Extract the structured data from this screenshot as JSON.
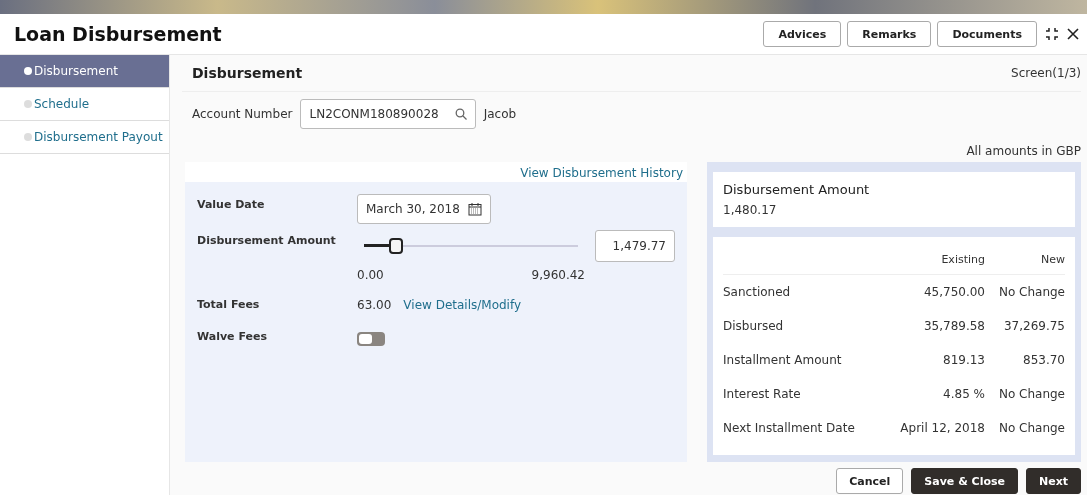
{
  "window": {
    "title": "Loan Disbursement",
    "buttons": [
      "Advices",
      "Remarks",
      "Documents"
    ]
  },
  "sidebar": {
    "items": [
      {
        "label": "Disbursement",
        "selected": true
      },
      {
        "label": "Schedule",
        "selected": false
      },
      {
        "label": "Disbursement Payout",
        "selected": false
      }
    ]
  },
  "section": {
    "title": "Disbursement",
    "screen": "Screen(1/3)"
  },
  "account": {
    "label": "Account Number",
    "value": "LN2CONM180890028",
    "name": "Jacob"
  },
  "currency_note": "All amounts in GBP",
  "history_link": "View Disbursement History",
  "form": {
    "value_date": {
      "label": "Value Date",
      "value": "March 30, 2018"
    },
    "amount": {
      "label": "Disbursement Amount",
      "level": 0.15,
      "value": "1,479.77",
      "min": "0.00",
      "max": "9,960.42"
    },
    "fees": {
      "label": "Total Fees",
      "value": "63.00",
      "link": "View Details/Modify"
    },
    "waive": {
      "label": "Walve Fees",
      "on": false
    }
  },
  "summary": {
    "title": "Disbursement Amount",
    "value": "1,480.17"
  },
  "comparison": {
    "columns": [
      "Existing",
      "New"
    ],
    "rows": [
      {
        "label": "Sanctioned",
        "existing": "45,750.00",
        "new": "No Change"
      },
      {
        "label": "Disbursed",
        "existing": "35,789.58",
        "new": "37,269.75"
      },
      {
        "label": "Installment Amount",
        "existing": "819.13",
        "new": "853.70"
      },
      {
        "label": "Interest Rate",
        "existing": "4.85 %",
        "new": "No Change"
      },
      {
        "label": "Next Installment Date",
        "existing": "April 12, 2018",
        "new": "No Change"
      }
    ]
  },
  "footer": {
    "buttons": [
      {
        "label": "Cancel",
        "kind": "secondary"
      },
      {
        "label": "Save & Close",
        "kind": "primary"
      },
      {
        "label": "Next",
        "kind": "primary"
      }
    ]
  }
}
